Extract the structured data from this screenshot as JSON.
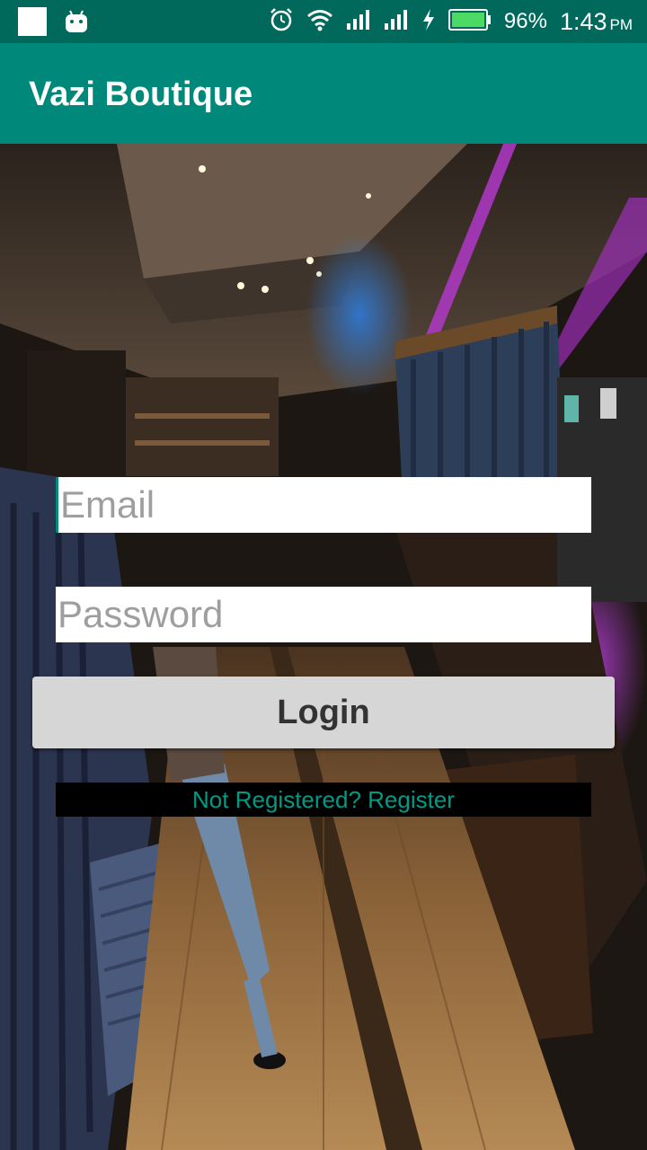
{
  "status_bar": {
    "battery_percent": "96%",
    "time": "1:43",
    "time_suffix": "PM",
    "icons": [
      "notification-square-icon",
      "android-icon",
      "alarm-icon",
      "wifi-icon",
      "signal-icon",
      "signal-icon",
      "charging-icon",
      "battery-icon"
    ]
  },
  "app_bar": {
    "title": "Vazi Boutique"
  },
  "form": {
    "email_placeholder": "Email",
    "password_placeholder": "Password",
    "login_label": "Login",
    "register_label": "Not Registered? Register"
  },
  "colors": {
    "status_bar": "#00695c",
    "app_bar": "#00897b",
    "accent": "#009a85",
    "button": "#d6d6d6"
  }
}
